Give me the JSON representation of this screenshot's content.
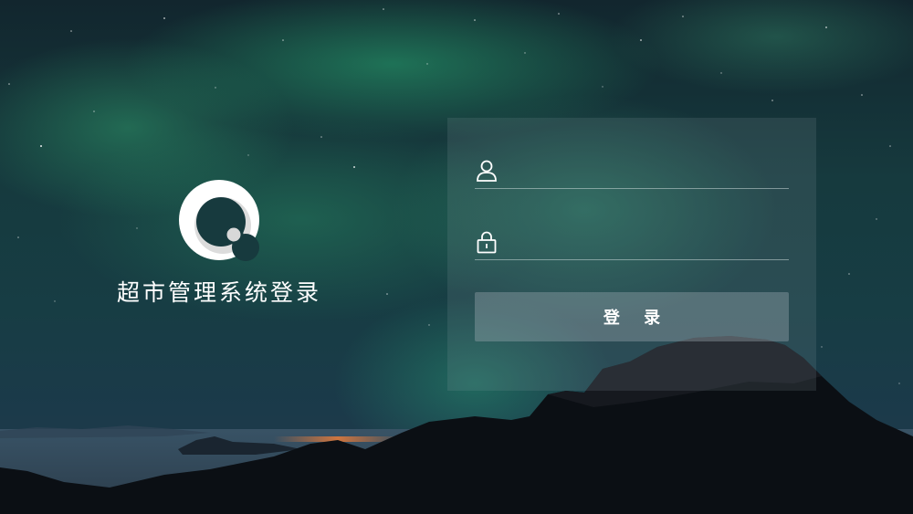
{
  "brand": {
    "title": "超市管理系统登录",
    "logo_icon": "q-ring-logo-icon"
  },
  "login_form": {
    "username": {
      "icon": "user-icon",
      "value": "",
      "placeholder": ""
    },
    "password": {
      "icon": "lock-icon",
      "value": "",
      "placeholder": ""
    },
    "submit_label": "登 录"
  },
  "colors": {
    "text": "#ffffff",
    "panel": "#8ca0a5",
    "button": "#aab4be",
    "aurora_green": "#28aa73"
  }
}
